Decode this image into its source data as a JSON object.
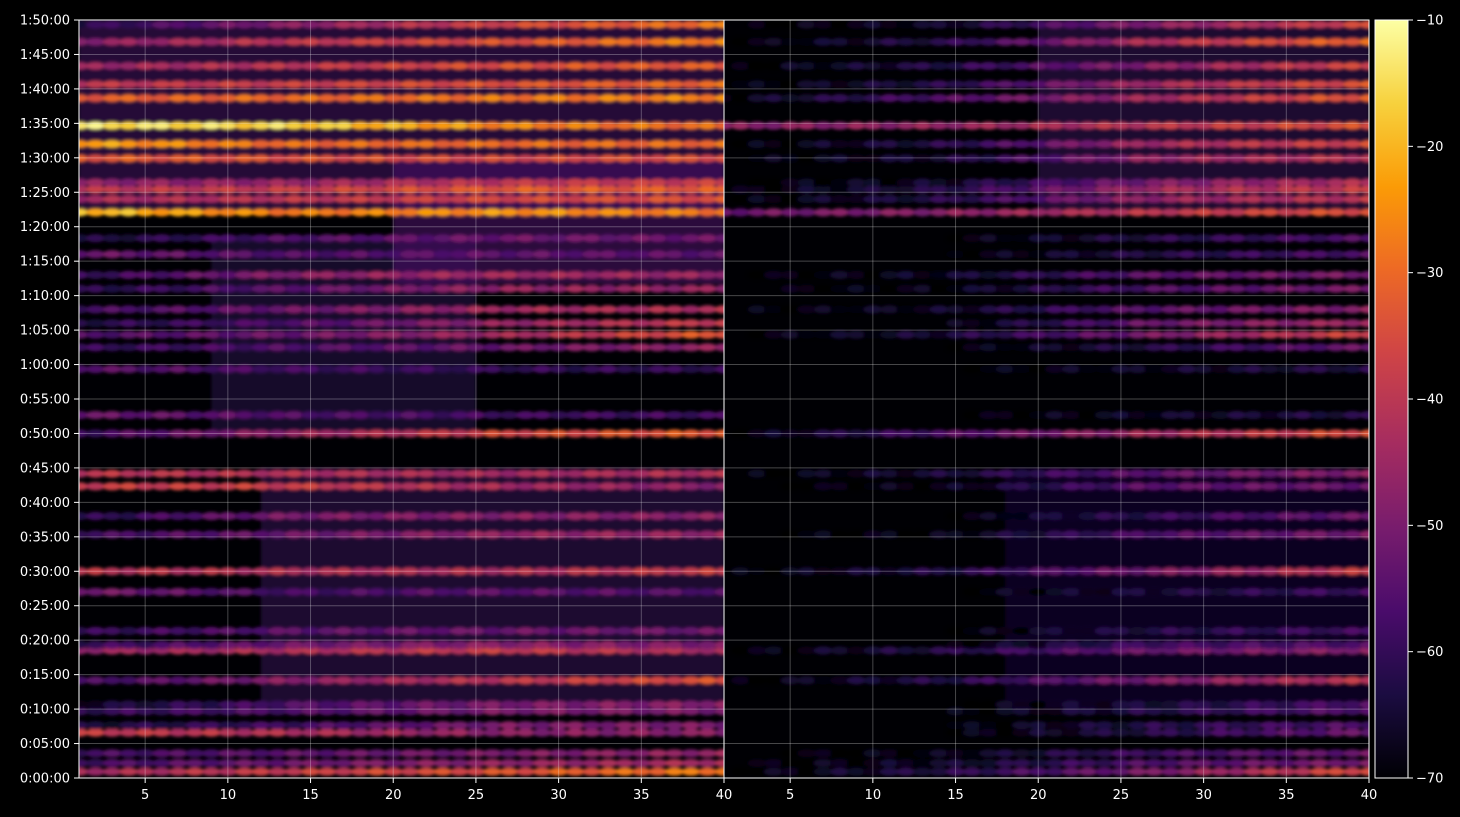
{
  "chart_data": {
    "type": "heatmap",
    "title": "",
    "xlabel": "",
    "ylabel": "",
    "panels": [
      {
        "name": "",
        "x_range": [
          1,
          40
        ],
        "x_ticks": [
          5,
          10,
          15,
          20,
          25,
          30,
          35,
          40
        ]
      },
      {
        "name": "",
        "x_range": [
          1,
          40
        ],
        "x_ticks": [
          5,
          10,
          15,
          20,
          25,
          30,
          35,
          40
        ]
      }
    ],
    "y_range_seconds": [
      0,
      6600
    ],
    "y_ticks": [
      "0:00:00",
      "0:05:00",
      "0:10:00",
      "0:15:00",
      "0:20:00",
      "0:25:00",
      "0:30:00",
      "0:35:00",
      "0:40:00",
      "0:45:00",
      "0:50:00",
      "0:55:00",
      "1:00:00",
      "1:05:00",
      "1:10:00",
      "1:15:00",
      "1:20:00",
      "1:25:00",
      "1:30:00",
      "1:35:00",
      "1:40:00",
      "1:45:00",
      "1:50:00"
    ],
    "grid": true,
    "colormap": "inferno",
    "colorbar": {
      "range": [
        -70,
        -10
      ],
      "ticks": [
        "−70",
        "−60",
        "−50",
        "−40",
        "−30",
        "−20",
        "−10"
      ]
    },
    "bands": [
      {
        "t": 55,
        "left": [
          -44,
          -38,
          -34,
          -27
        ],
        "right": [
          -70,
          -62,
          -50,
          -34
        ]
      },
      {
        "t": 130,
        "left": [
          -58,
          -52,
          -47,
          -43
        ],
        "right": [
          -70,
          -66,
          -56,
          -50
        ]
      },
      {
        "t": 215,
        "left": [
          -58,
          -54,
          -50,
          -46
        ],
        "right": [
          -70,
          -68,
          -58,
          -52
        ]
      },
      {
        "t": 395,
        "left": [
          -38,
          -42,
          -48,
          -48
        ],
        "right": [
          -70,
          -70,
          -62,
          -52
        ]
      },
      {
        "t": 460,
        "left": [
          -64,
          -58,
          -50,
          -50
        ],
        "right": [
          -70,
          -70,
          -62,
          -56
        ]
      },
      {
        "t": 580,
        "left": [
          -60,
          -56,
          -50,
          -50
        ],
        "right": [
          -70,
          -70,
          -62,
          -55
        ]
      },
      {
        "t": 640,
        "left": [
          -66,
          -56,
          -50,
          -48
        ],
        "right": [
          -70,
          -70,
          -64,
          -56
        ]
      },
      {
        "t": 850,
        "left": [
          -58,
          -48,
          -40,
          -34
        ],
        "right": [
          -70,
          -62,
          -50,
          -40
        ]
      },
      {
        "t": 1110,
        "left": [
          -46,
          -42,
          -38,
          -44
        ],
        "right": [
          -70,
          -62,
          -52,
          -48
        ]
      },
      {
        "t": 1160,
        "left": [
          -60,
          -52,
          -48,
          -50
        ],
        "right": [
          -70,
          -70,
          -58,
          -56
        ]
      },
      {
        "t": 1280,
        "left": [
          -60,
          -54,
          -52,
          -52
        ],
        "right": [
          -70,
          -70,
          -62,
          -58
        ]
      },
      {
        "t": 1620,
        "left": [
          -50,
          -58,
          -54,
          -56
        ],
        "right": [
          -70,
          -70,
          -64,
          -58
        ]
      },
      {
        "t": 1800,
        "left": [
          -40,
          -42,
          -42,
          -38
        ],
        "right": [
          -70,
          -62,
          -50,
          -38
        ]
      },
      {
        "t": 2120,
        "left": [
          -58,
          -52,
          -46,
          -46
        ],
        "right": [
          -70,
          -68,
          -56,
          -50
        ]
      },
      {
        "t": 2280,
        "left": [
          -62,
          -50,
          -48,
          -48
        ],
        "right": [
          -70,
          -70,
          -60,
          -52
        ]
      },
      {
        "t": 2540,
        "left": [
          -38,
          -38,
          -44,
          -48
        ],
        "right": [
          -70,
          -68,
          -54,
          -52
        ]
      },
      {
        "t": 2650,
        "left": [
          -40,
          -42,
          -44,
          -42
        ],
        "right": [
          -70,
          -64,
          -54,
          -48
        ]
      },
      {
        "t": 3000,
        "left": [
          -58,
          -46,
          -36,
          -32
        ],
        "right": [
          -70,
          -56,
          -44,
          -34
        ]
      },
      {
        "t": 3160,
        "left": [
          -52,
          -56,
          -58,
          -58
        ],
        "right": [
          -70,
          -70,
          -66,
          -62
        ]
      },
      {
        "t": 3560,
        "left": [
          -54,
          -58,
          -60,
          -60
        ],
        "right": [
          -70,
          -70,
          -66,
          -62
        ]
      },
      {
        "t": 3750,
        "left": [
          -60,
          -56,
          -52,
          -46
        ],
        "right": [
          -70,
          -70,
          -62,
          -52
        ]
      },
      {
        "t": 3860,
        "left": [
          -56,
          -52,
          -44,
          -32
        ],
        "right": [
          -70,
          -64,
          -50,
          -36
        ]
      },
      {
        "t": 3960,
        "left": [
          -62,
          -56,
          -46,
          -38
        ],
        "right": [
          -70,
          -70,
          -52,
          -44
        ]
      },
      {
        "t": 4080,
        "left": [
          -58,
          -52,
          -44,
          -42
        ],
        "right": [
          -70,
          -66,
          -54,
          -48
        ]
      },
      {
        "t": 4260,
        "left": [
          -62,
          -54,
          -46,
          -46
        ],
        "right": [
          -70,
          -68,
          -56,
          -50
        ]
      },
      {
        "t": 4380,
        "left": [
          -60,
          -48,
          -44,
          -46
        ],
        "right": [
          -70,
          -66,
          -54,
          -50
        ]
      },
      {
        "t": 4560,
        "left": [
          -52,
          -56,
          -54,
          -54
        ],
        "right": [
          -70,
          -70,
          -62,
          -56
        ]
      },
      {
        "t": 4700,
        "left": [
          -64,
          -56,
          -52,
          -52
        ],
        "right": [
          -70,
          -70,
          -62,
          -56
        ]
      },
      {
        "t": 4925,
        "left": [
          -18,
          -28,
          -24,
          -28
        ],
        "right": [
          -52,
          -48,
          -40,
          -34
        ]
      },
      {
        "t": 5040,
        "left": [
          -44,
          -40,
          -36,
          -34
        ],
        "right": [
          -70,
          -62,
          -46,
          -40
        ]
      },
      {
        "t": 5125,
        "left": [
          -40,
          -38,
          -32,
          -32
        ],
        "right": [
          -70,
          -62,
          -44,
          -38
        ]
      },
      {
        "t": 5185,
        "left": [
          -48,
          -46,
          -40,
          -38
        ],
        "right": [
          -70,
          -66,
          -50,
          -42
        ]
      },
      {
        "t": 5395,
        "left": [
          -32,
          -34,
          -36,
          -34
        ],
        "right": [
          -70,
          -64,
          -46,
          -40
        ]
      },
      {
        "t": 5520,
        "left": [
          -22,
          -30,
          -30,
          -30
        ],
        "right": [
          -70,
          -62,
          -44,
          -36
        ]
      },
      {
        "t": 5680,
        "left": [
          -14,
          -16,
          -26,
          -30
        ],
        "right": [
          -48,
          -46,
          -40,
          -34
        ]
      },
      {
        "t": 5920,
        "left": [
          -32,
          -30,
          -28,
          -26
        ],
        "right": [
          -68,
          -56,
          -44,
          -32
        ]
      },
      {
        "t": 6040,
        "left": [
          -40,
          -38,
          -34,
          -30
        ],
        "right": [
          -70,
          -62,
          -44,
          -34
        ]
      },
      {
        "t": 6200,
        "left": [
          -46,
          -40,
          -34,
          -32
        ],
        "right": [
          -70,
          -62,
          -48,
          -36
        ]
      },
      {
        "t": 6410,
        "left": [
          -48,
          -40,
          -34,
          -26
        ],
        "right": [
          -70,
          -62,
          -42,
          -30
        ]
      },
      {
        "t": 6560,
        "left": [
          -62,
          -48,
          -36,
          -28
        ],
        "right": [
          -70,
          -66,
          -48,
          -36
        ]
      }
    ]
  }
}
